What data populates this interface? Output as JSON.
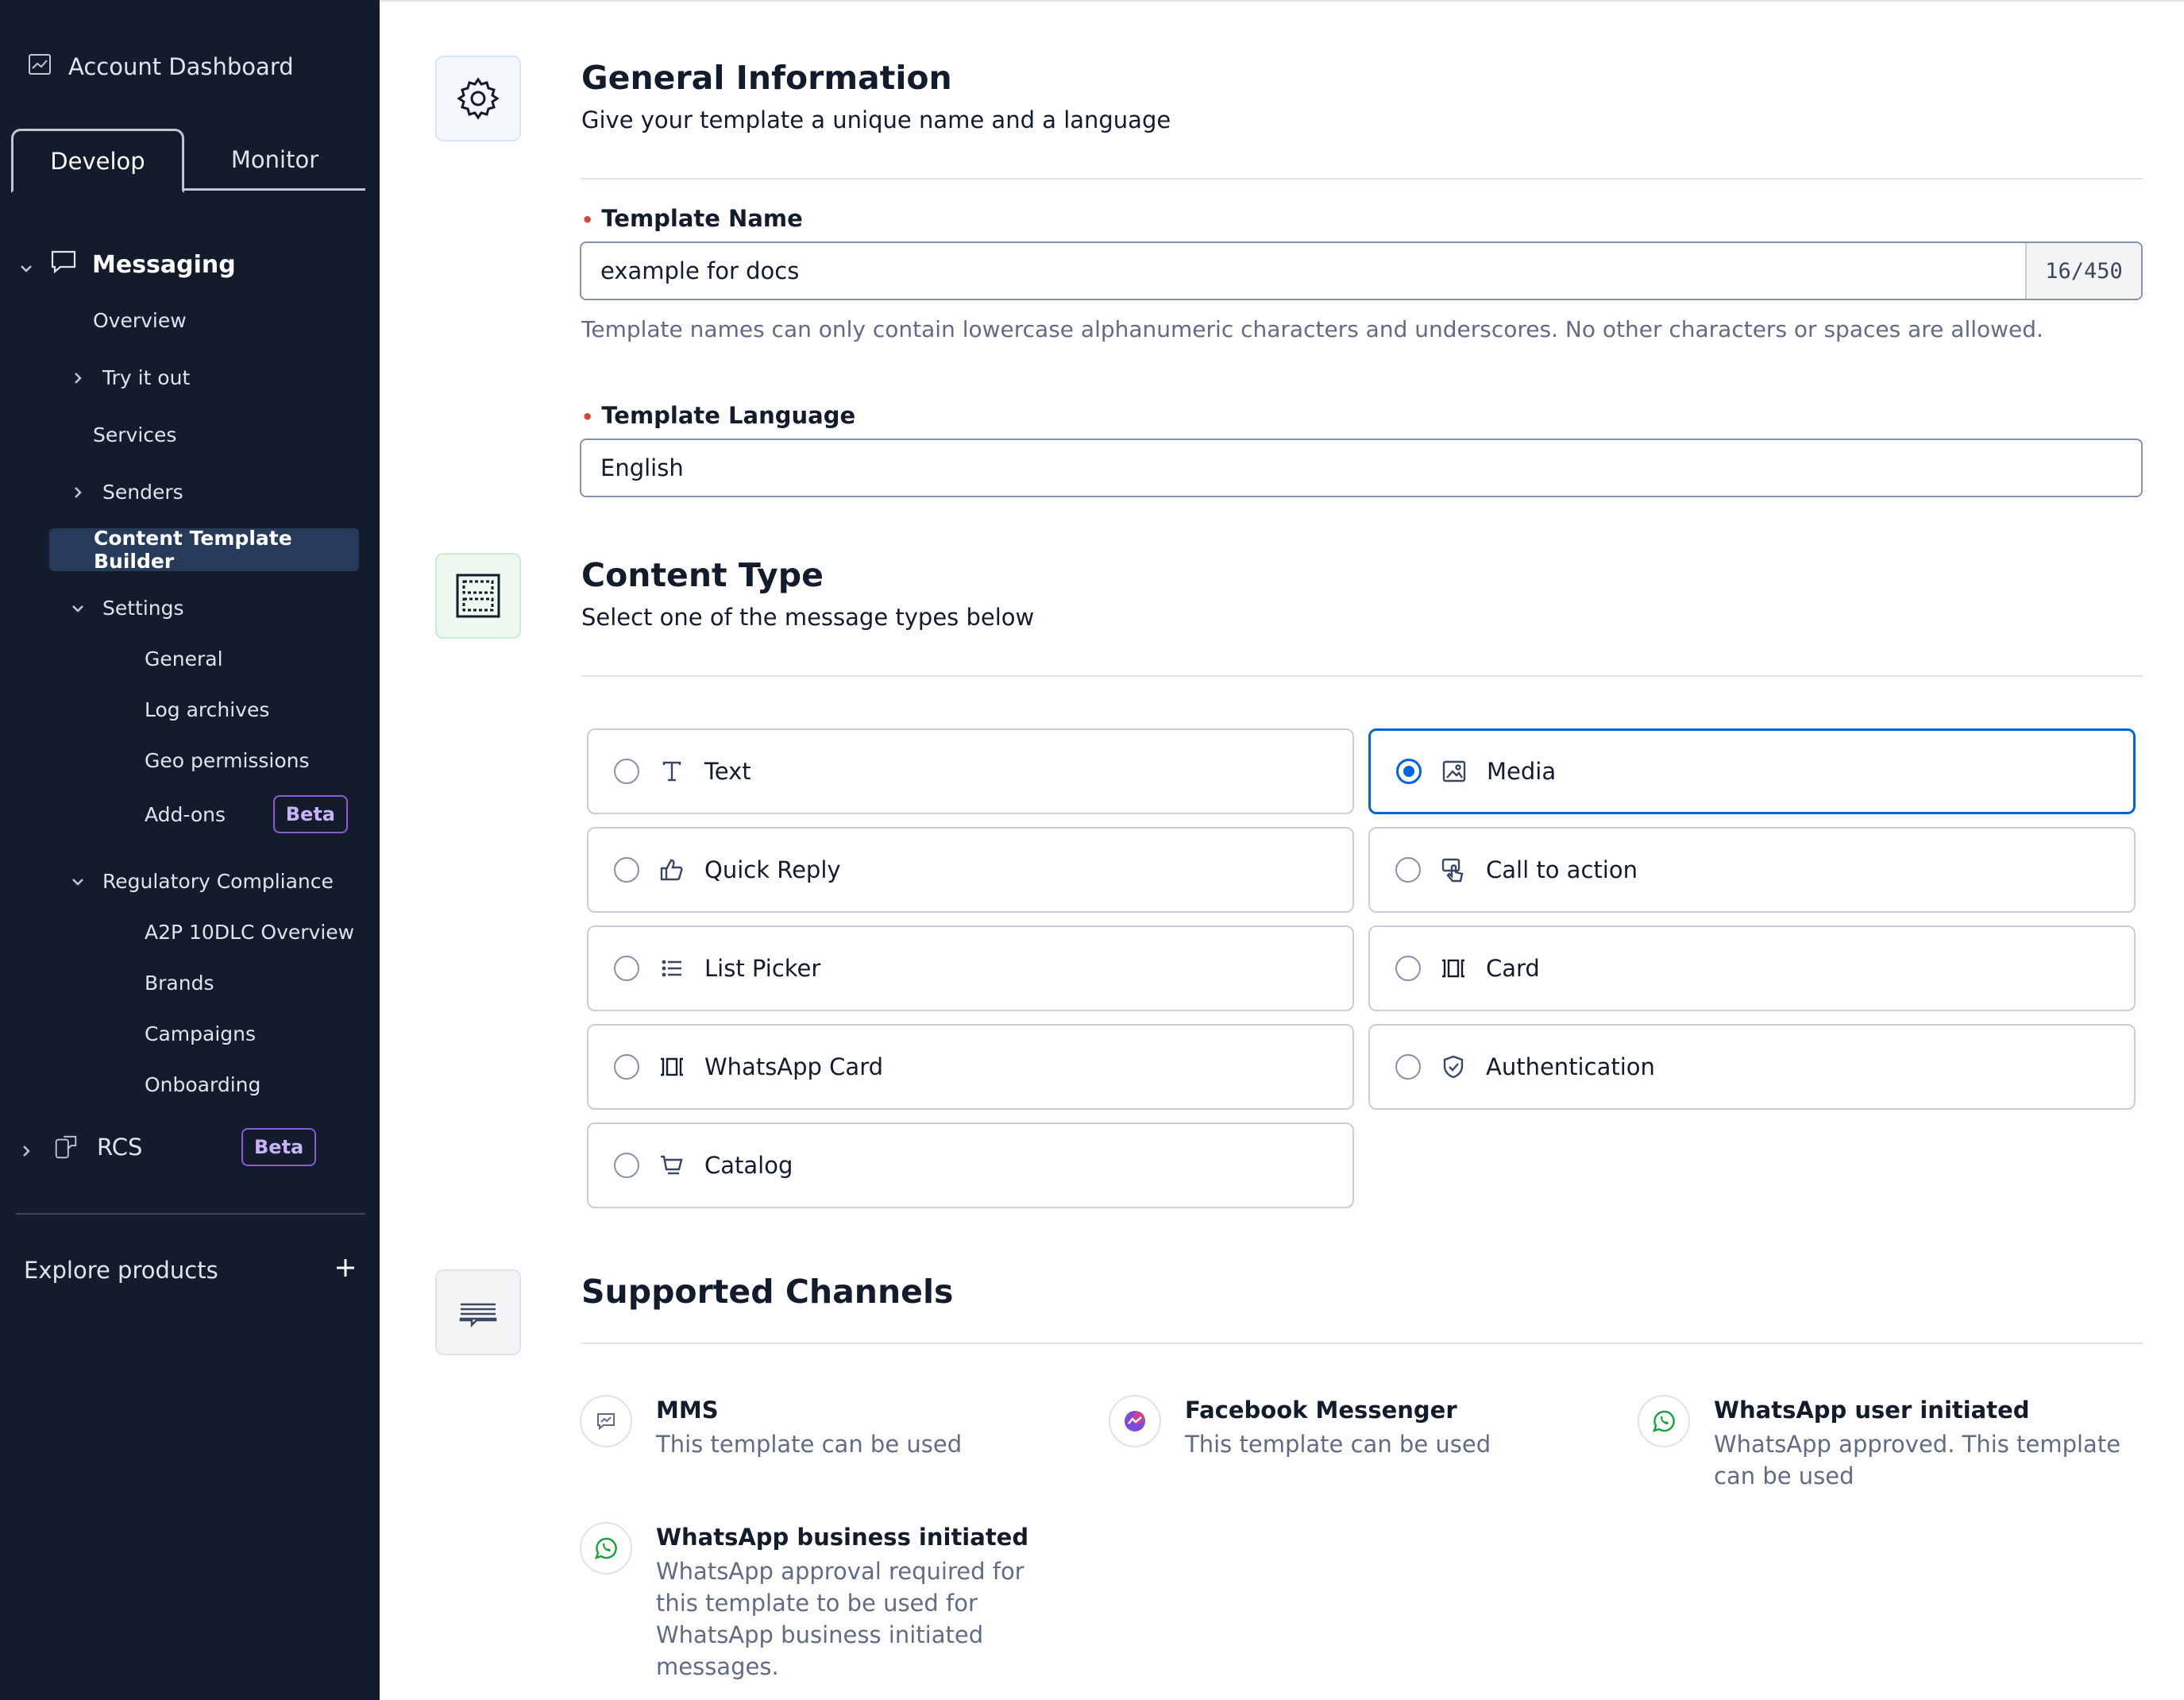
{
  "sidebar": {
    "dashboard_label": "Account Dashboard",
    "tabs": [
      {
        "label": "Develop",
        "active": true
      },
      {
        "label": "Monitor",
        "active": false
      }
    ],
    "messaging_label": "Messaging",
    "items": {
      "overview": "Overview",
      "try_it_out": "Try it out",
      "services": "Services",
      "senders": "Senders",
      "content_template_builder": "Content Template Builder",
      "settings": "Settings",
      "general": "General",
      "log_archives": "Log archives",
      "geo_permissions": "Geo permissions",
      "add_ons": "Add-ons",
      "regulatory_compliance": "Regulatory Compliance",
      "a2p": "A2P 10DLC Overview",
      "brands": "Brands",
      "campaigns": "Campaigns",
      "onboarding": "Onboarding",
      "rcs": "RCS"
    },
    "beta_label": "Beta",
    "explore_label": "Explore products"
  },
  "general": {
    "title": "General Information",
    "subtitle": "Give your template a unique name and a language",
    "name_label": "Template Name",
    "name_value": "example for docs",
    "name_counter": "16/450",
    "name_help": "Template names can only contain lowercase alphanumeric characters and underscores. No other characters or spaces are allowed.",
    "language_label": "Template Language",
    "language_value": "English"
  },
  "content_type": {
    "title": "Content Type",
    "subtitle": "Select one of the message types below",
    "options": [
      {
        "label": "Text",
        "icon": "text-icon",
        "selected": false
      },
      {
        "label": "Media",
        "icon": "image-icon",
        "selected": true
      },
      {
        "label": "Quick Reply",
        "icon": "thumbs-up-icon",
        "selected": false
      },
      {
        "label": "Call to action",
        "icon": "tap-icon",
        "selected": false
      },
      {
        "label": "List Picker",
        "icon": "list-icon",
        "selected": false
      },
      {
        "label": "Card",
        "icon": "card-icon",
        "selected": false
      },
      {
        "label": "WhatsApp Card",
        "icon": "card-icon",
        "selected": false
      },
      {
        "label": "Authentication",
        "icon": "shield-check-icon",
        "selected": false
      },
      {
        "label": "Catalog",
        "icon": "cart-icon",
        "selected": false
      }
    ]
  },
  "channels": {
    "title": "Supported Channels",
    "items": [
      {
        "name": "MMS",
        "desc": "This template can be used",
        "icon": "mms-icon"
      },
      {
        "name": "Facebook Messenger",
        "desc": "This template can be used",
        "icon": "messenger-icon"
      },
      {
        "name": "WhatsApp user initiated",
        "desc": "WhatsApp approved. This template can be used",
        "icon": "whatsapp-icon"
      },
      {
        "name": "WhatsApp business initiated",
        "desc": "WhatsApp approval required for this template to be used for WhatsApp business initiated messages.",
        "icon": "whatsapp-icon"
      }
    ]
  },
  "colors": {
    "sidebar_bg": "#121c2d",
    "accent": "#0263e0",
    "beta": "#8c5bd8",
    "required": "#d6433b",
    "whatsapp": "#14a33a"
  }
}
